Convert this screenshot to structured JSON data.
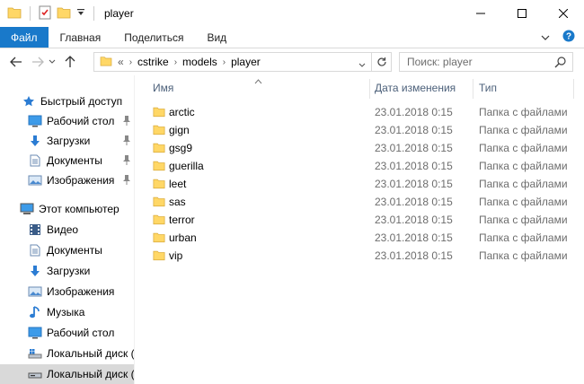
{
  "window": {
    "title": "player"
  },
  "ribbon": {
    "tabs": [
      "Файл",
      "Главная",
      "Поделиться",
      "Вид"
    ]
  },
  "address": {
    "overflow": "«",
    "crumbs": [
      "cstrike",
      "models",
      "player"
    ]
  },
  "search": {
    "placeholder": "Поиск: player"
  },
  "nav": {
    "quick_access": "Быстрый доступ",
    "quick_items": [
      "Рабочий стол",
      "Загрузки",
      "Документы",
      "Изображения"
    ],
    "this_pc": "Этот компьютер",
    "pc_items": [
      "Видео",
      "Документы",
      "Загрузки",
      "Изображения",
      "Музыка",
      "Рабочий стол",
      "Локальный диск (C",
      "Локальный диск (D"
    ]
  },
  "columns": {
    "name": "Имя",
    "date": "Дата изменения",
    "type": "Тип"
  },
  "files": [
    {
      "name": "arctic",
      "date": "23.01.2018 0:15",
      "type": "Папка с файлами"
    },
    {
      "name": "gign",
      "date": "23.01.2018 0:15",
      "type": "Папка с файлами"
    },
    {
      "name": "gsg9",
      "date": "23.01.2018 0:15",
      "type": "Папка с файлами"
    },
    {
      "name": "guerilla",
      "date": "23.01.2018 0:15",
      "type": "Папка с файлами"
    },
    {
      "name": "leet",
      "date": "23.01.2018 0:15",
      "type": "Папка с файлами"
    },
    {
      "name": "sas",
      "date": "23.01.2018 0:15",
      "type": "Папка с файлами"
    },
    {
      "name": "terror",
      "date": "23.01.2018 0:15",
      "type": "Папка с файлами"
    },
    {
      "name": "urban",
      "date": "23.01.2018 0:15",
      "type": "Папка с файлами"
    },
    {
      "name": "vip",
      "date": "23.01.2018 0:15",
      "type": "Папка с файлами"
    }
  ],
  "colors": {
    "file_tab": "#1979ca",
    "folder": "#ffd766",
    "header_text": "#4c607a",
    "selected": "#d9d9d9"
  }
}
